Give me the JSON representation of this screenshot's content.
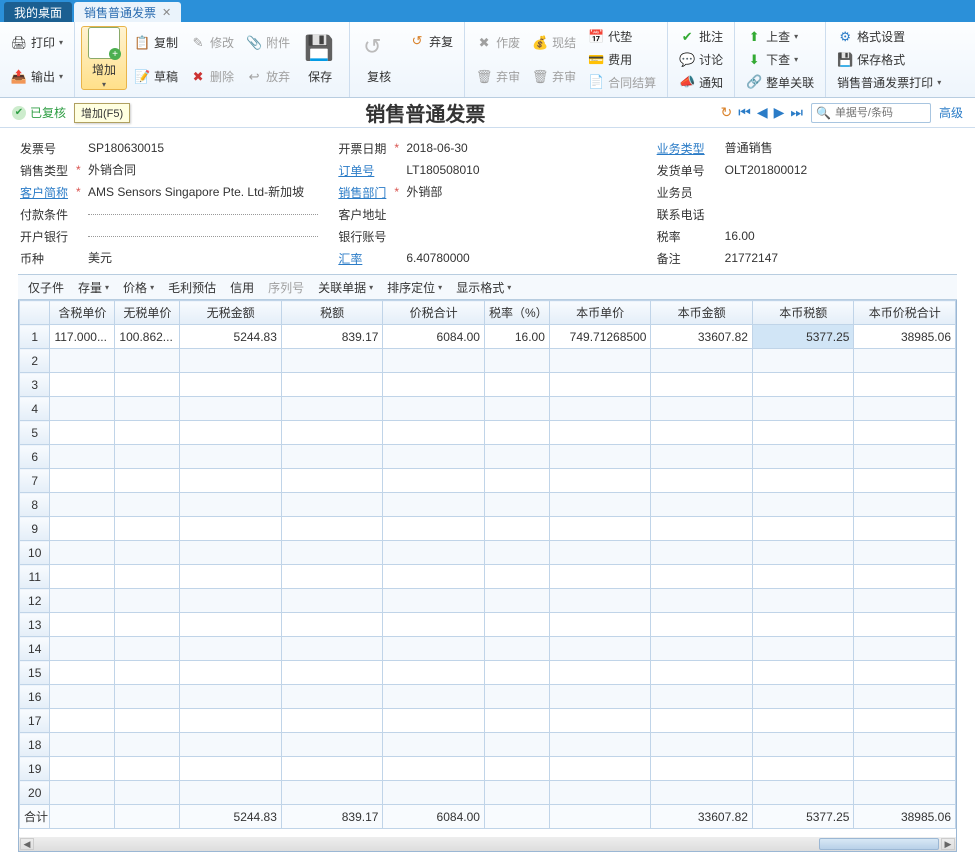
{
  "tabs": {
    "desktop": "我的桌面",
    "active": "销售普通发票"
  },
  "ribbon": {
    "print": "打印",
    "export": "输出",
    "add": "增加",
    "copy": "复制",
    "edit": "修改",
    "attach": "附件",
    "save": "保存",
    "draft": "草稿",
    "delete": "删除",
    "drop": "放弃",
    "redo": "弃复",
    "recheck": "复核",
    "void": "作废",
    "abandon": "弃审",
    "cash": "现结",
    "advance": "代垫",
    "fee": "费用",
    "contract": "合同结算",
    "approve": "批注",
    "discuss": "讨论",
    "notify": "通知",
    "up": "上查",
    "down": "下查",
    "relation": "整单关联",
    "format": "格式设置",
    "save_format": "保存格式",
    "print_invoice": "销售普通发票打印"
  },
  "subhdr": {
    "status": "已复核",
    "tooltip": "增加(F5)",
    "title": "销售普通发票",
    "search_placeholder": "单据号/条码",
    "adv": "高级"
  },
  "form": {
    "invoice_no_lbl": "发票号",
    "invoice_no": "SP180630015",
    "sale_type_lbl": "销售类型",
    "sale_type": "外销合同",
    "customer_lbl": "客户简称",
    "customer": "AMS Sensors Singapore Pte. Ltd-新加坡",
    "pay_terms_lbl": "付款条件",
    "pay_terms": "",
    "bank_lbl": "开户银行",
    "bank": "",
    "currency_lbl": "币种",
    "currency": "美元",
    "date_lbl": "开票日期",
    "date": "2018-06-30",
    "order_lbl": "订单号",
    "order": "LT180508010",
    "dept_lbl": "销售部门",
    "dept": "外销部",
    "addr_lbl": "客户地址",
    "addr": "",
    "account_lbl": "银行账号",
    "account": "",
    "rate_lbl": "汇率",
    "rate": "6.40780000",
    "biztype_lbl": "业务类型",
    "biztype": "普通销售",
    "ship_lbl": "发货单号",
    "ship": "OLT201800012",
    "sales_lbl": "业务员",
    "sales": "",
    "phone_lbl": "联系电话",
    "phone": "",
    "tax_lbl": "税率",
    "tax": "16.00",
    "remark_lbl": "备注",
    "remark": "21772147"
  },
  "tbtns": {
    "child": "仅子件",
    "stock": "存量",
    "price": "价格",
    "profit": "毛利预估",
    "credit": "信用",
    "serial": "序列号",
    "related": "关联单据",
    "sort": "排序定位",
    "display": "显示格式"
  },
  "thead": [
    "含税单价",
    "无税单价",
    "无税金额",
    "税额",
    "价税合计",
    "税率（%）",
    "本币单价",
    "本币金额",
    "本币税额",
    "本币价税合计"
  ],
  "rows": [
    {
      "c0": "117.000...",
      "c1": "100.862...",
      "c2": "5244.83",
      "c3": "839.17",
      "c4": "6084.00",
      "c5": "16.00",
      "c6": "749.71268500",
      "c7": "33607.82",
      "c8": "5377.25",
      "c9": "38985.06"
    }
  ],
  "total_label": "合计",
  "totals": {
    "c2": "5244.83",
    "c3": "839.17",
    "c4": "6084.00",
    "c7": "33607.82",
    "c8": "5377.25",
    "c9": "38985.06"
  }
}
